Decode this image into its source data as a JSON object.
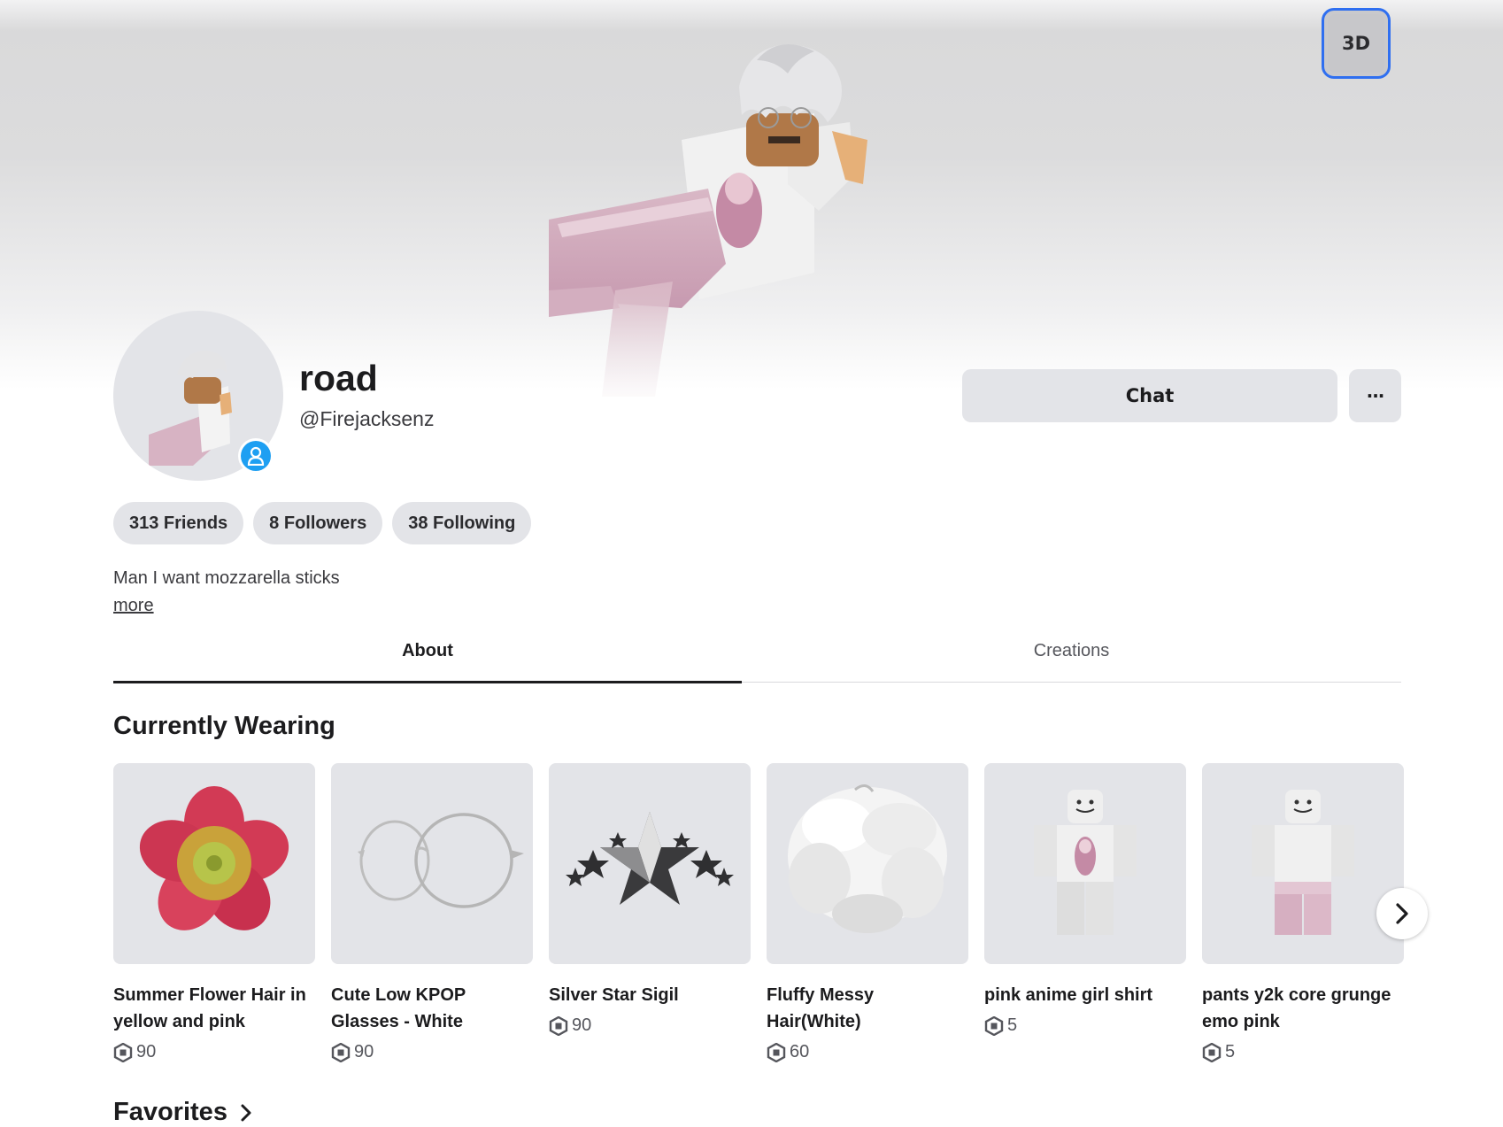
{
  "header": {
    "view_toggle_label": "3D"
  },
  "profile": {
    "display_name": "road",
    "username": "@Firejacksenz",
    "chat_label": "Chat",
    "more_menu_label": "···",
    "stats": [
      {
        "label": "313 Friends"
      },
      {
        "label": "8 Followers"
      },
      {
        "label": "38 Following"
      }
    ],
    "bio": "Man I want mozzarella sticks",
    "bio_more_label": "more"
  },
  "tabs": [
    {
      "label": "About",
      "active": true
    },
    {
      "label": "Creations",
      "active": false
    }
  ],
  "currently_wearing": {
    "title": "Currently Wearing",
    "items": [
      {
        "name": "Summer Flower Hair in yellow and pink",
        "price": "90",
        "icon": "flower-hair-thumbnail"
      },
      {
        "name": "Cute Low KPOP Glasses - White",
        "price": "90",
        "icon": "glasses-thumbnail"
      },
      {
        "name": "Silver Star Sigil",
        "price": "90",
        "icon": "star-sigil-thumbnail"
      },
      {
        "name": "Fluffy Messy Hair(White)",
        "price": "60",
        "icon": "fluffy-hair-thumbnail"
      },
      {
        "name": "pink anime girl shirt",
        "price": "5",
        "icon": "shirt-thumbnail"
      },
      {
        "name": "pants y2k core grunge emo pink",
        "price": "5",
        "icon": "pants-thumbnail"
      }
    ]
  },
  "favorites": {
    "title": "Favorites"
  },
  "colors": {
    "accent_blue": "#2f6ff0",
    "presence_blue": "#1e9ff2",
    "surface_gray": "#e3e4e8"
  }
}
